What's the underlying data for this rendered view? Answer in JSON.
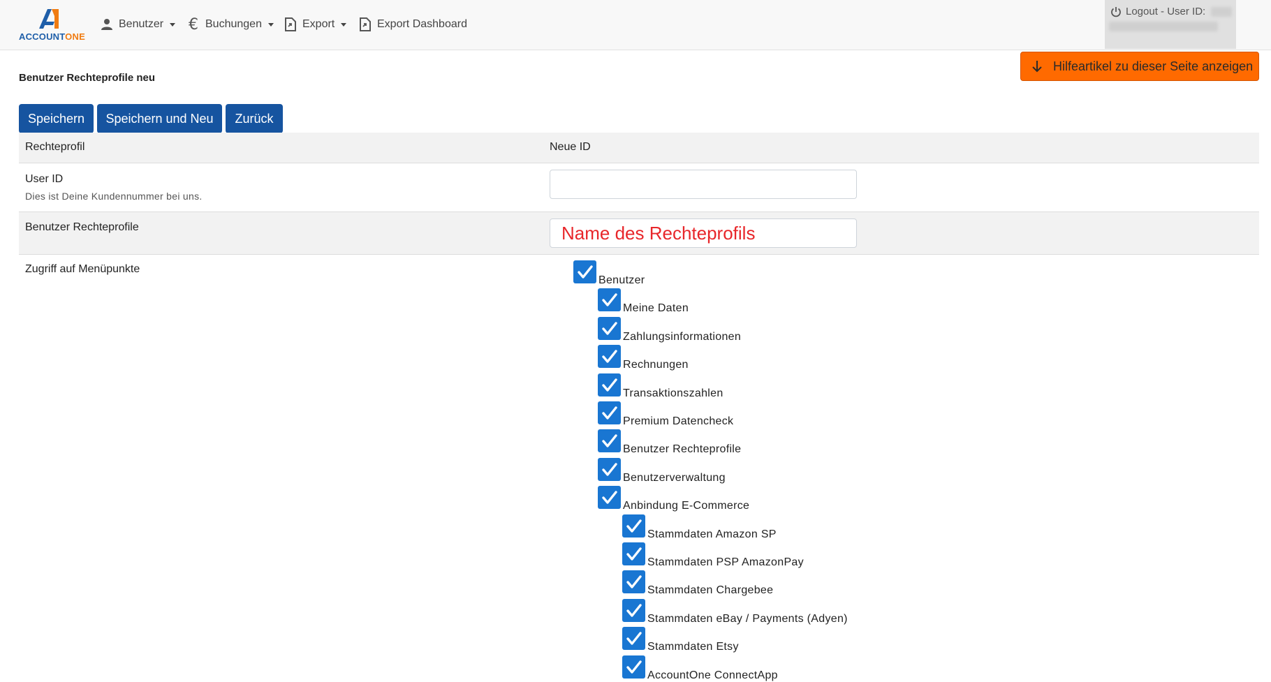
{
  "brand": {
    "logo_letter": "A",
    "name_part1": "ACCOUNT",
    "name_part2": "ONE",
    "primary": "#1f5fa9",
    "accent": "#f07c12"
  },
  "nav": {
    "items": [
      {
        "label": "Benutzer",
        "icon": "user-icon",
        "dropdown": true
      },
      {
        "label": "Buchungen",
        "icon": "euro-icon",
        "dropdown": true
      },
      {
        "label": "Export",
        "icon": "file-export-icon",
        "dropdown": true
      },
      {
        "label": "Export Dashboard",
        "icon": "file-export-icon",
        "dropdown": false
      }
    ],
    "logout_label": "Logout - User ID:"
  },
  "help_button": {
    "label": "Hilfeartikel zu dieser Seite anzeigen",
    "icon": "arrow-down-icon",
    "color": "#ff6a00"
  },
  "page": {
    "title": "Benutzer Rechteprofile neu"
  },
  "actions": {
    "save": "Speichern",
    "save_new": "Speichern und Neu",
    "back": "Zurück",
    "color": "#1654a0"
  },
  "form": {
    "profile_label": "Rechteprofil",
    "profile_value": "Neue ID",
    "user_id_label": "User ID",
    "user_id_hint": "Dies ist Deine Kundennummer bei uns.",
    "user_id_value": "",
    "profiles_label": "Benutzer Rechteprofile",
    "profiles_placeholder": "Name des Rechteprofils",
    "menu_access_label": "Zugriff auf Menüpunkte"
  },
  "tree": [
    {
      "label": "Benutzer",
      "level": 0,
      "checked": true
    },
    {
      "label": "Meine Daten",
      "level": 1,
      "checked": true
    },
    {
      "label": "Zahlungsinformationen",
      "level": 1,
      "checked": true
    },
    {
      "label": "Rechnungen",
      "level": 1,
      "checked": true
    },
    {
      "label": "Transaktionszahlen",
      "level": 1,
      "checked": true
    },
    {
      "label": "Premium Datencheck",
      "level": 1,
      "checked": true
    },
    {
      "label": "Benutzer Rechteprofile",
      "level": 1,
      "checked": true
    },
    {
      "label": "Benutzerverwaltung",
      "level": 1,
      "checked": true
    },
    {
      "label": "Anbindung E-Commerce",
      "level": 1,
      "checked": true
    },
    {
      "label": "Stammdaten Amazon SP",
      "level": 2,
      "checked": true
    },
    {
      "label": "Stammdaten PSP AmazonPay",
      "level": 2,
      "checked": true
    },
    {
      "label": "Stammdaten Chargebee",
      "level": 2,
      "checked": true
    },
    {
      "label": "Stammdaten eBay / Payments (Adyen)",
      "level": 2,
      "checked": true
    },
    {
      "label": "Stammdaten Etsy",
      "level": 2,
      "checked": true
    },
    {
      "label": "AccountOne ConnectApp",
      "level": 2,
      "checked": true
    }
  ],
  "checkbox_color": "#1976d2"
}
